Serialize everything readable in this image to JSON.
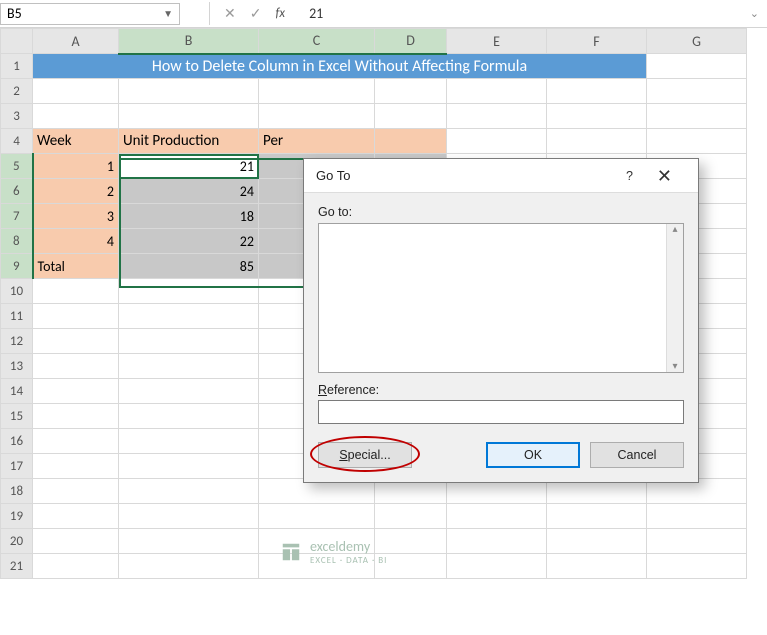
{
  "namebox": "B5",
  "formula_value": "21",
  "icons": {
    "cancel": "✕",
    "confirm": "✓",
    "fx": "fx",
    "dropdown": "▼",
    "expand": "⌄",
    "scroll_up": "▴",
    "scroll_down": "▾",
    "help": "?",
    "close": "✕"
  },
  "columns": [
    "A",
    "B",
    "C",
    "D",
    "E",
    "F",
    "G"
  ],
  "rows": [
    "1",
    "2",
    "3",
    "4",
    "5",
    "6",
    "7",
    "8",
    "9",
    "10",
    "11",
    "12",
    "13",
    "14",
    "15",
    "16",
    "17",
    "18",
    "19",
    "20",
    "21"
  ],
  "title_text": "How to Delete Column in Excel Without Affecting Formula",
  "headers": {
    "week": "Week",
    "unit": "Unit Production",
    "per": "Per"
  },
  "week_vals": [
    "1",
    "2",
    "3",
    "4"
  ],
  "unit_vals": [
    "21",
    "24",
    "18",
    "22"
  ],
  "total_label": "Total",
  "total_value": "85",
  "dialog": {
    "title": "Go To",
    "goto_label": "Go to:",
    "reference_label_pre": "R",
    "reference_label_rest": "eference:",
    "reference_value": "",
    "special": "Special...",
    "ok": "OK",
    "cancel": "Cancel"
  },
  "watermark": {
    "name": "exceldemy",
    "sub": "EXCEL · DATA · BI"
  }
}
